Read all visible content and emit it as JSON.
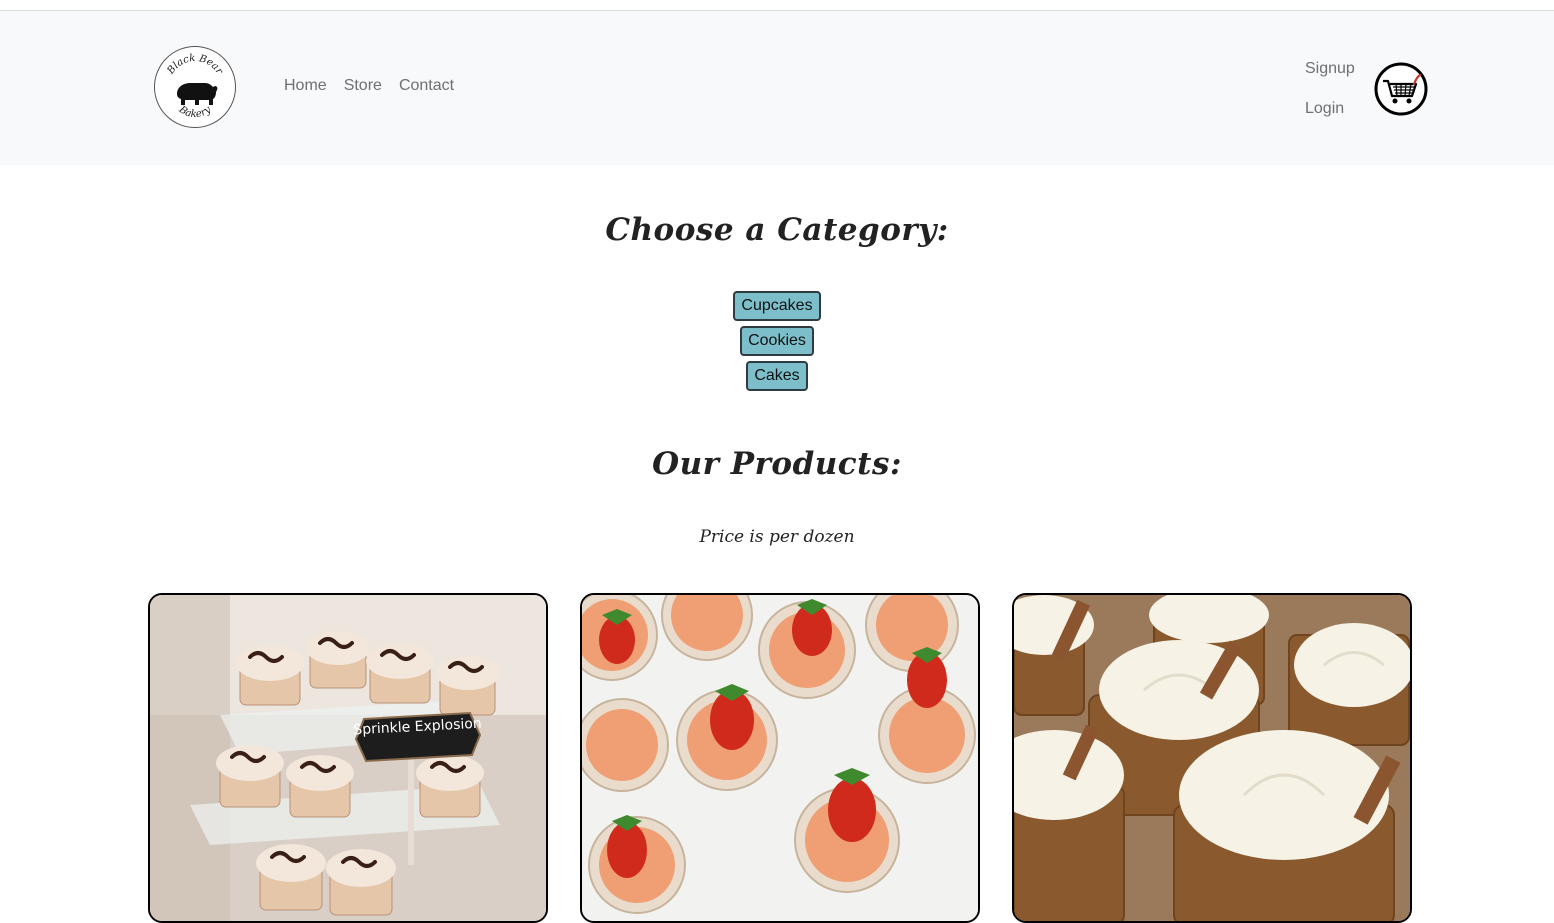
{
  "brand": {
    "logo_text_top": "Black Bear",
    "logo_text_bottom": "Bakery"
  },
  "nav": {
    "items": [
      {
        "label": "Home"
      },
      {
        "label": "Store"
      },
      {
        "label": "Contact"
      }
    ]
  },
  "auth": {
    "signup": "Signup",
    "login": "Login"
  },
  "cart": {
    "icon": "shopping-cart-icon"
  },
  "categories": {
    "title": "Choose a Category:",
    "buttons": [
      {
        "label": "Cupcakes"
      },
      {
        "label": "Cookies"
      },
      {
        "label": "Cakes"
      }
    ]
  },
  "products": {
    "title": "Our Products:",
    "note": "Price is per dozen",
    "cards": [
      {
        "image_label": "Sprinkle Explosion"
      },
      {
        "image_label": ""
      },
      {
        "image_label": ""
      }
    ]
  },
  "colors": {
    "navbar_bg": "#f8f9fa",
    "category_button": "#7cbfcb",
    "text": "#222222"
  }
}
